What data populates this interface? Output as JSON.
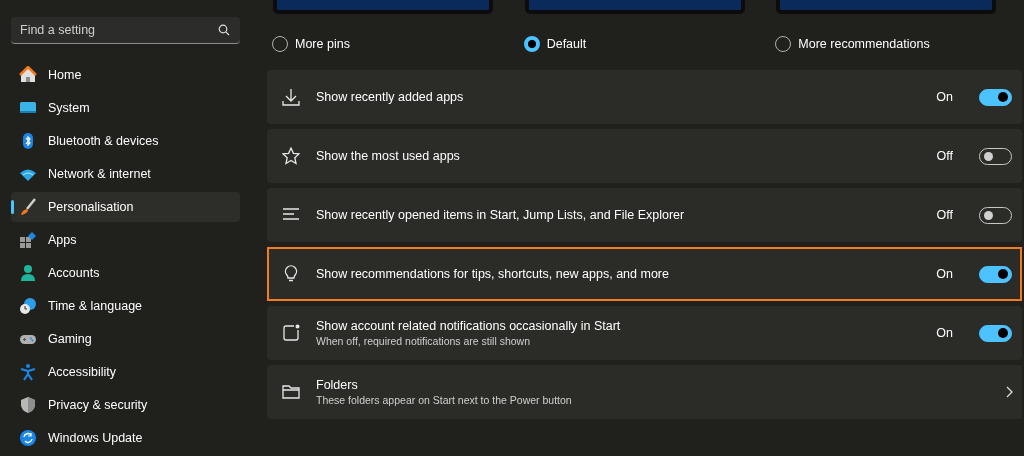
{
  "search": {
    "placeholder": "Find a setting"
  },
  "nav": [
    {
      "label": "Home",
      "selected": false
    },
    {
      "label": "System",
      "selected": false
    },
    {
      "label": "Bluetooth & devices",
      "selected": false
    },
    {
      "label": "Network & internet",
      "selected": false
    },
    {
      "label": "Personalisation",
      "selected": true
    },
    {
      "label": "Apps",
      "selected": false
    },
    {
      "label": "Accounts",
      "selected": false
    },
    {
      "label": "Time & language",
      "selected": false
    },
    {
      "label": "Gaming",
      "selected": false
    },
    {
      "label": "Accessibility",
      "selected": false
    },
    {
      "label": "Privacy & security",
      "selected": false
    },
    {
      "label": "Windows Update",
      "selected": false
    }
  ],
  "layouts": [
    {
      "label": "More pins",
      "selected": false
    },
    {
      "label": "Default",
      "selected": true
    },
    {
      "label": "More recommendations",
      "selected": false
    }
  ],
  "settings": [
    {
      "kind": "toggle",
      "label": "Show recently added apps",
      "state_label": "On",
      "on": true,
      "highlighted": false
    },
    {
      "kind": "toggle",
      "label": "Show the most used apps",
      "state_label": "Off",
      "on": false,
      "highlighted": false
    },
    {
      "kind": "toggle",
      "label": "Show recently opened items in Start, Jump Lists, and File Explorer",
      "state_label": "Off",
      "on": false,
      "highlighted": false
    },
    {
      "kind": "toggle",
      "label": "Show recommendations for tips, shortcuts, new apps, and more",
      "state_label": "On",
      "on": true,
      "highlighted": true
    },
    {
      "kind": "toggle",
      "label": "Show account related notifications occasionally in Start",
      "description": "When off, required notifications are still shown",
      "state_label": "On",
      "on": true,
      "highlighted": false
    },
    {
      "kind": "link",
      "label": "Folders",
      "description": "These folders appear on Start next to the Power button",
      "highlighted": false
    }
  ]
}
